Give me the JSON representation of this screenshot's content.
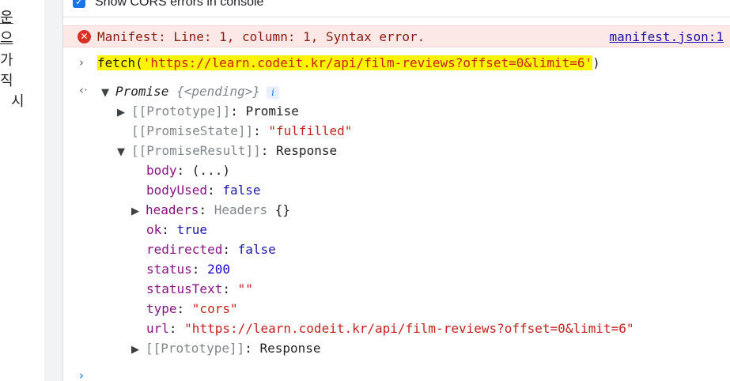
{
  "left_page": {
    "chars": [
      "운",
      "으",
      "가",
      "직",
      "시"
    ]
  },
  "settings": {
    "show_cors_label": "Show CORS errors in console",
    "show_cors_checked": "✓"
  },
  "error": {
    "icon": "error-icon",
    "message": "Manifest: Line: 1, column: 1, Syntax error.",
    "link": "manifest.json:1"
  },
  "input": {
    "fetch_prefix": "fetch(",
    "fetch_url": "'https://learn.codeit.kr/api/film-reviews?offset=0&limit=6'",
    "fetch_suffix": ")"
  },
  "result": {
    "promise_label": "Promise",
    "promise_state_brace": "{<pending>}",
    "info": "i",
    "prototype_key": "[[Prototype]]",
    "prototype_val": "Promise",
    "state_key": "[[PromiseState]]",
    "state_val": "\"fulfilled\"",
    "result_key": "[[PromiseResult]]",
    "result_val": "Response",
    "props": {
      "body_key": "body",
      "body_val": "(...)",
      "bodyUsed_key": "bodyUsed",
      "bodyUsed_val": "false",
      "headers_key": "headers",
      "headers_type": "Headers",
      "headers_val": "{}",
      "ok_key": "ok",
      "ok_val": "true",
      "redirected_key": "redirected",
      "redirected_val": "false",
      "status_key": "status",
      "status_val": "200",
      "statusText_key": "statusText",
      "statusText_val": "\"\"",
      "type_key": "type",
      "type_val": "\"cors\"",
      "url_key": "url",
      "url_val": "\"https://learn.codeit.kr/api/film-reviews?offset=0&limit=6\"",
      "proto_key": "[[Prototype]]",
      "proto_val": "Response"
    }
  },
  "icons": {
    "input_prompt": "chevron-right-icon",
    "output_return": "return-arrow-icon",
    "next_prompt": "chevron-right-icon"
  },
  "colors": {
    "string": "#c5221f",
    "keyword": "#1a1aa6",
    "number": "#1c00cf",
    "error_bg": "#fce8e6",
    "highlight": "#fdf500"
  }
}
